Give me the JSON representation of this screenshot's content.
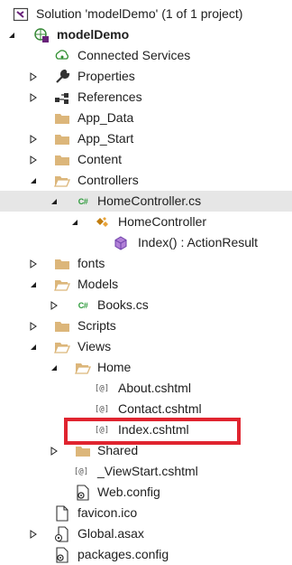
{
  "tree": {
    "solution": "Solution 'modelDemo' (1 of 1 project)",
    "project": "modelDemo",
    "connected_services": "Connected Services",
    "properties": "Properties",
    "references": "References",
    "app_data": "App_Data",
    "app_start": "App_Start",
    "content": "Content",
    "controllers": "Controllers",
    "home_controller_file": "HomeController.cs",
    "home_controller_class": "HomeController",
    "index_method": "Index() : ActionResult",
    "fonts": "fonts",
    "models": "Models",
    "books": "Books.cs",
    "scripts": "Scripts",
    "views": "Views",
    "home": "Home",
    "about": "About.cshtml",
    "contact": "Contact.cshtml",
    "index": "Index.cshtml",
    "shared": "Shared",
    "viewstart": "_ViewStart.cshtml",
    "webconfig_views": "Web.config",
    "favicon": "favicon.ico",
    "global": "Global.asax",
    "packages": "packages.config"
  },
  "icon_text": {
    "cs": "C#",
    "razor": "[@]"
  },
  "colors": {
    "selected_bg": "#e6e6e6",
    "folder": "#dcb67a",
    "highlight": "#e0242f",
    "cs_green": "#2c9a3a",
    "class_orange": "#c27d0e",
    "method_purple": "#6c3ea8"
  }
}
